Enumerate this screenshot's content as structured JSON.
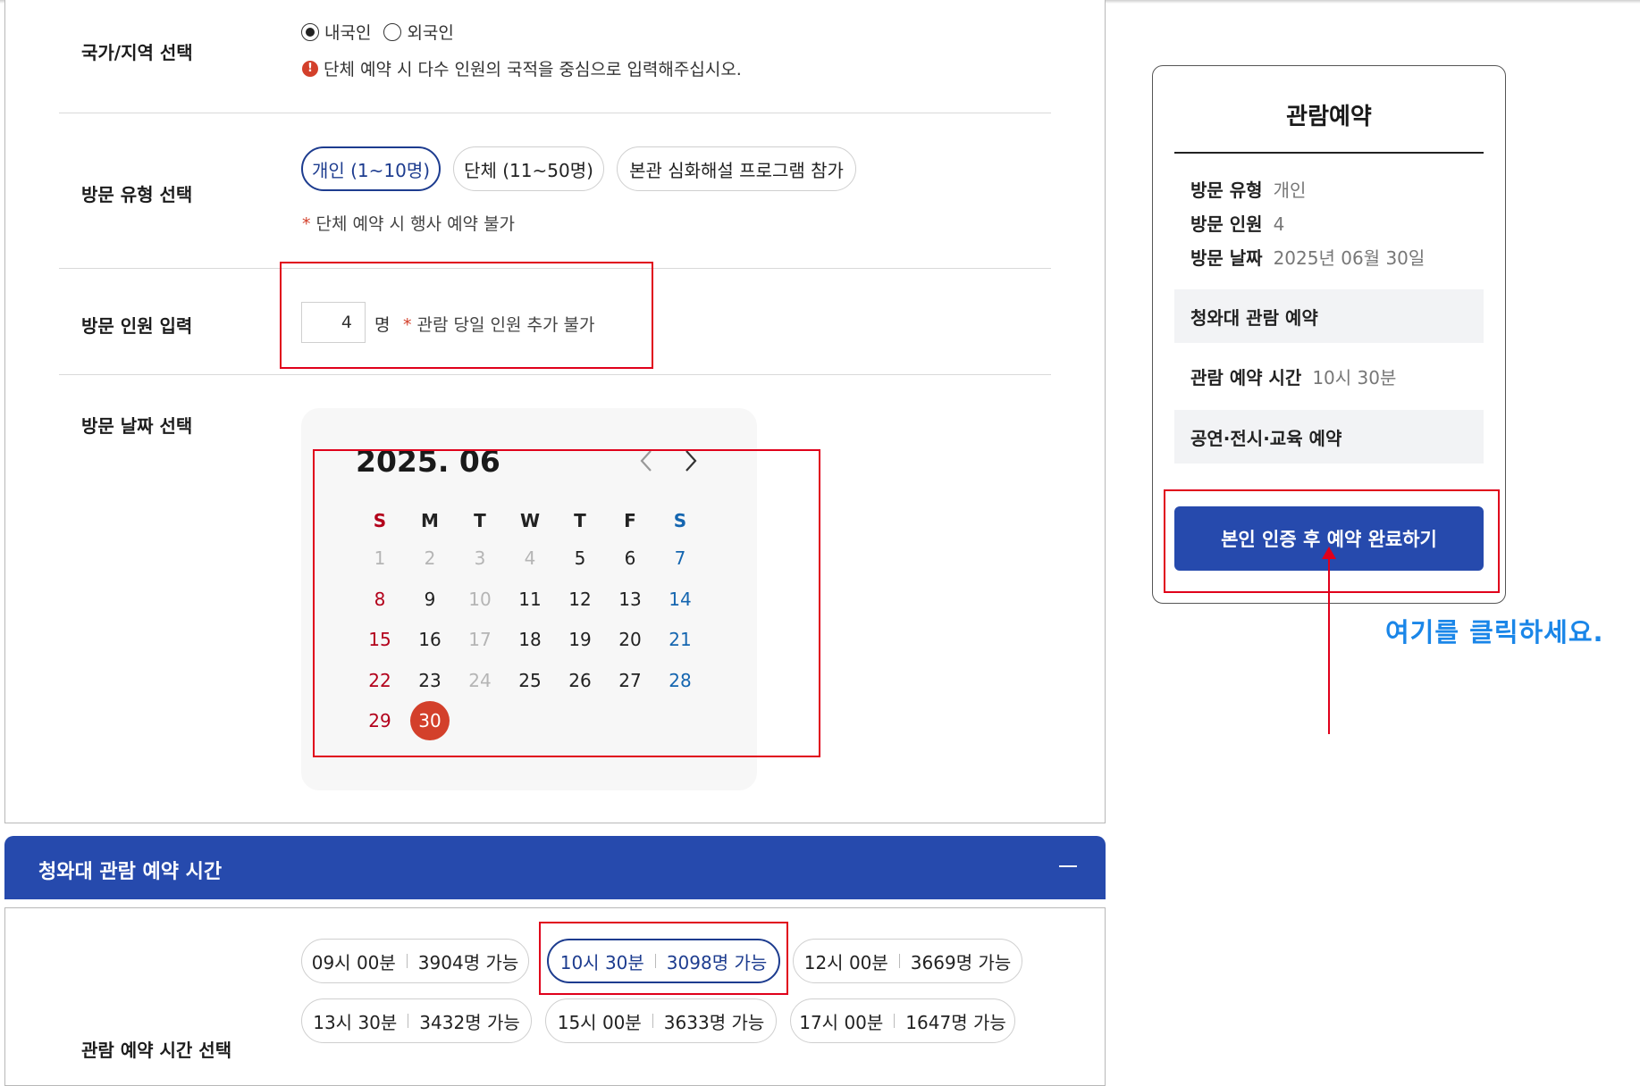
{
  "nationality": {
    "label": "국가/지역 선택",
    "options": [
      "내국인",
      "외국인"
    ],
    "selected": "내국인",
    "notice": "단체 예약 시 다수 인원의 국적을 중심으로 입력해주십시오.",
    "info_icon": "info-icon"
  },
  "visit_type": {
    "label": "방문 유형 선택",
    "options": [
      "개인 (1~10명)",
      "단체 (11~50명)",
      "본관 심화해설 프로그램 참가"
    ],
    "selected": "개인 (1~10명)",
    "note_star": "*",
    "note": "단체 예약 시 행사 예약 불가"
  },
  "visitors": {
    "label": "방문 인원 입력",
    "value": "4",
    "unit": "명",
    "note_star": "*",
    "note": "관람 당일 인원 추가 불가"
  },
  "date": {
    "label": "방문 날짜 선택",
    "calendar_title": "2025. 06",
    "prev_icon": "chevron-left-icon",
    "next_icon": "chevron-right-icon",
    "weekdays": [
      "S",
      "M",
      "T",
      "W",
      "T",
      "F",
      "S"
    ],
    "days": [
      [
        "1",
        "2",
        "3",
        "4",
        "5",
        "6",
        "7"
      ],
      [
        "8",
        "9",
        "10",
        "11",
        "12",
        "13",
        "14"
      ],
      [
        "15",
        "16",
        "17",
        "18",
        "19",
        "20",
        "21"
      ],
      [
        "22",
        "23",
        "24",
        "25",
        "26",
        "27",
        "28"
      ],
      [
        "29",
        "30",
        "",
        "",
        "",
        "",
        ""
      ]
    ],
    "disabled": [
      "1",
      "2",
      "3",
      "4",
      "10",
      "17",
      "24"
    ],
    "selected_day": "30"
  },
  "section_bar": {
    "title": "청와대 관람 예약 시간",
    "toggle_icon": "minus-icon"
  },
  "time_slots": {
    "label": "관람 예약 시간 선택",
    "slots": [
      {
        "time": "09시 00분",
        "avail": "3904명 가능"
      },
      {
        "time": "10시 30분",
        "avail": "3098명 가능"
      },
      {
        "time": "12시 00분",
        "avail": "3669명 가능"
      },
      {
        "time": "13시 30분",
        "avail": "3432명 가능"
      },
      {
        "time": "15시 00분",
        "avail": "3633명 가능"
      },
      {
        "time": "17시 00분",
        "avail": "1647명 가능"
      }
    ],
    "selected_time": "10시 30분"
  },
  "summary": {
    "title": "관람예약",
    "visit_type_key": "방문 유형",
    "visit_type_val": "개인",
    "visitors_key": "방문 인원",
    "visitors_val": "4",
    "date_key": "방문 날짜",
    "date_val": "2025년 06월 30일",
    "section1": "청와대 관람 예약",
    "time_key": "관람 예약 시간",
    "time_val": "10시 30분",
    "section2": "공연·전시·교육 예약",
    "cta": "본인 인증 후 예약 완료하기"
  },
  "hint": {
    "text": "여기를 클릭하세요."
  },
  "colors": {
    "brand_blue": "#264aad",
    "accent_red": "#d3402b",
    "annotation_red": "#e0001b",
    "hint_blue": "#1a86e8",
    "sunday": "#b3001b",
    "saturday": "#1566b0"
  }
}
